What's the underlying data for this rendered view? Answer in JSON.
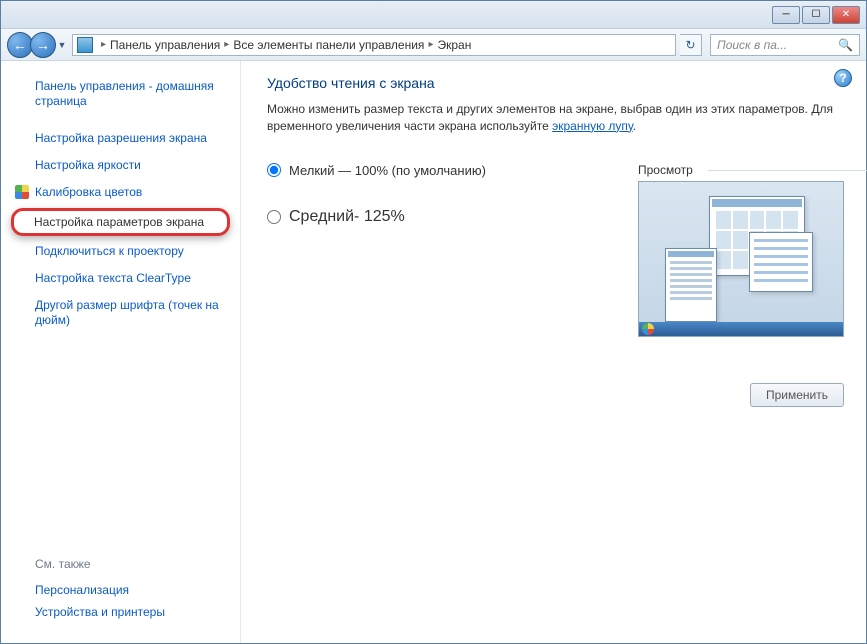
{
  "breadcrumb": {
    "l1": "Панель управления",
    "l2": "Все элементы панели управления",
    "l3": "Экран"
  },
  "search": {
    "placeholder": "Поиск в па..."
  },
  "sidebar": {
    "home": "Панель управления - домашняя страница",
    "links": [
      "Настройка разрешения экрана",
      "Настройка яркости",
      "Калибровка цветов",
      "Настройка параметров экрана",
      "Подключиться к проектору",
      "Настройка текста ClearType",
      "Другой размер шрифта (точек на дюйм)"
    ],
    "seealso_hd": "См. также",
    "seealso": [
      "Персонализация",
      "Устройства и принтеры"
    ]
  },
  "main": {
    "title": "Удобство чтения с экрана",
    "desc1": "Можно изменить размер текста и других элементов на экране, выбрав один из этих параметров. Для временного увеличения части экрана используйте ",
    "magnifier_link": "экранную лупу",
    "radio_small": "Мелкий — 100% (по умолчанию)",
    "radio_medium": "Средний- 125%",
    "preview_hd": "Просмотр",
    "apply": "Применить"
  }
}
